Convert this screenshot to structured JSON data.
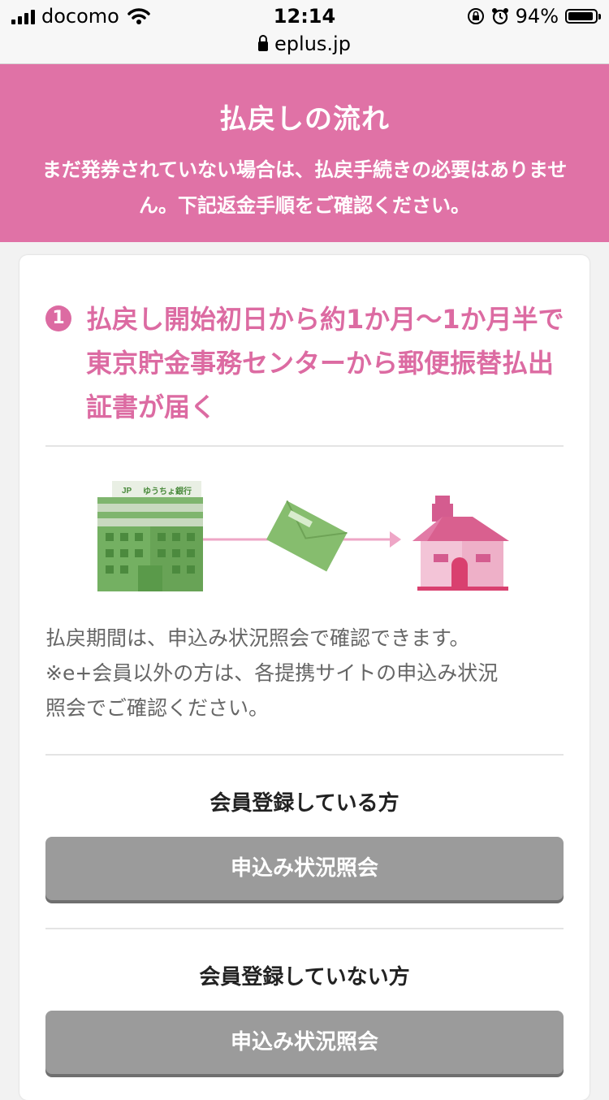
{
  "status_bar": {
    "carrier": "docomo",
    "time": "12:14",
    "battery": "94%",
    "url": "eplus.jp"
  },
  "header": {
    "title": "払戻しの流れ",
    "description": "まだ発券されていない場合は、払戻手続きの必要はありません。下記返金手順をご確認ください。"
  },
  "step": {
    "number": "1",
    "title": "払戻し開始初日から約1か月〜1か月半で東京貯金事務センターから郵便振替払出証書が届く"
  },
  "illustration": {
    "building_sign": "ゆうちょ銀行",
    "icons": [
      "post-bank-building-icon",
      "envelope-icon",
      "house-icon"
    ]
  },
  "description": {
    "line1": "払戻期間は、申込み状況照会で確認できます。",
    "line2": "※e+会員以外の方は、各提携サイトの申込み状況",
    "line3": "照会でご確認ください。"
  },
  "members": {
    "label": "会員登録している方",
    "button": "申込み状況照会"
  },
  "non_members": {
    "label": "会員登録していない方",
    "button": "申込み状況照会"
  },
  "colors": {
    "brand_pink": "#e072a6",
    "title_pink": "#dc6ba2",
    "button_gray": "#9b9b9b"
  }
}
